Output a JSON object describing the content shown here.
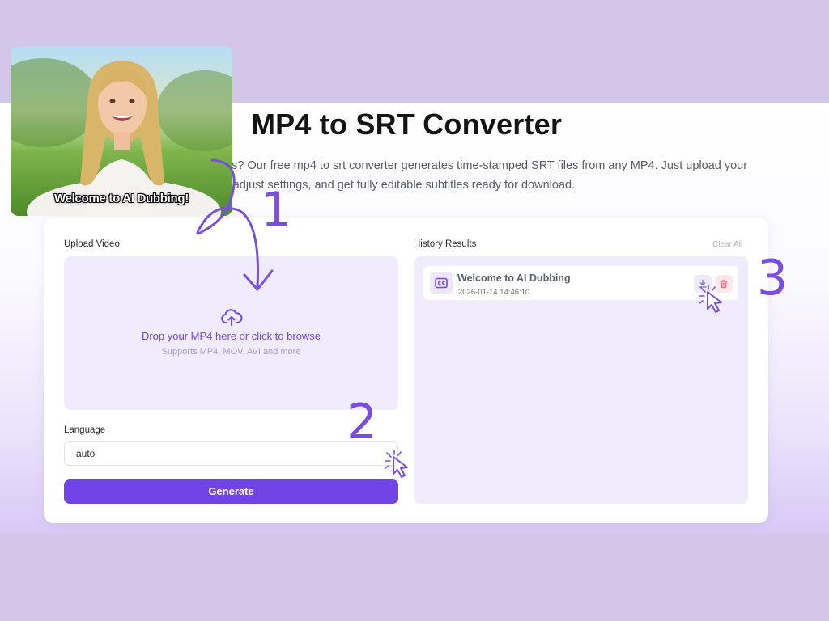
{
  "page": {
    "title": "MP4 to SRT Converter",
    "subtitle_line1": "eos? Our free mp4 to srt converter generates time-stamped SRT files from any MP4. Just upload your",
    "subtitle_line2": "w, adjust settings, and get fully editable subtitles ready for download."
  },
  "upload": {
    "label": "Upload Video",
    "drop_text": "Drop your MP4 here or click to browse",
    "supports_text": "Supports MP4, MOV, AVI and more",
    "icon": "cloud-upload-icon"
  },
  "language": {
    "label": "Language",
    "value": "auto"
  },
  "generate_button": "Generate",
  "history": {
    "label": "History Results",
    "clear_all": "Clear All",
    "items": [
      {
        "name": "Welcome to AI Dubbing",
        "date": "2026-01-14 14:46:10",
        "icon": "subtitles-icon"
      }
    ]
  },
  "preview": {
    "caption": "Welcome to AI Dubbing!"
  },
  "steps": [
    "1",
    "2",
    "3"
  ],
  "colors": {
    "accent": "#7144e8",
    "background": "#d3c6e9",
    "panel": "#f0ebfd",
    "delete": "#e86a7d"
  }
}
